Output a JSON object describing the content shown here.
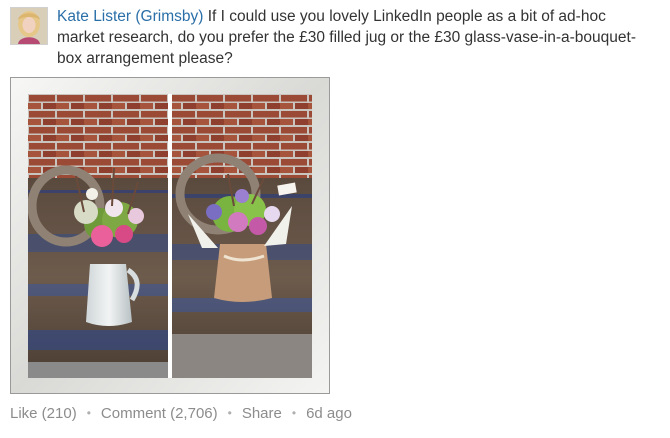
{
  "post": {
    "author": "Kate Lister (Grimsby)",
    "text": "If I could use you lovely LinkedIn people as a bit of ad-hoc market research, do you prefer the £30 filled jug or the £30 glass-vase-in-a-bouquet-box arrangement please?"
  },
  "actions": {
    "like": "Like (210)",
    "comment": "Comment (2,706)",
    "share": "Share",
    "time": "6d ago",
    "separator": "•"
  },
  "colors": {
    "link": "#2a6fa8",
    "body_text": "#333333",
    "meta_text": "#8c8c8c"
  }
}
